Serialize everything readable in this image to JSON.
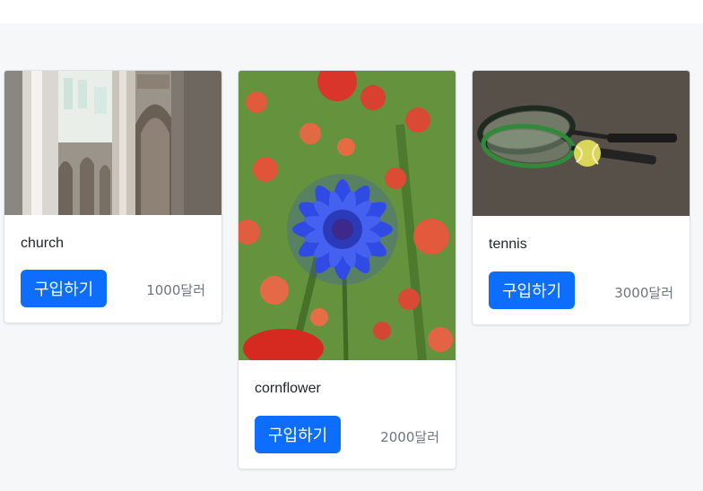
{
  "products": [
    {
      "title": "church",
      "buy_label": "구입하기",
      "price": "1000달러",
      "image": "church-interior-image"
    },
    {
      "title": "cornflower",
      "buy_label": "구입하기",
      "price": "2000달러",
      "image": "cornflower-image"
    },
    {
      "title": "tennis",
      "buy_label": "구입하기",
      "price": "3000달러",
      "image": "tennis-racket-image"
    }
  ],
  "colors": {
    "primary": "#0d6efd",
    "background": "#f6f7f9",
    "card_border": "#dfe2e6",
    "price_text": "#6c757d"
  }
}
